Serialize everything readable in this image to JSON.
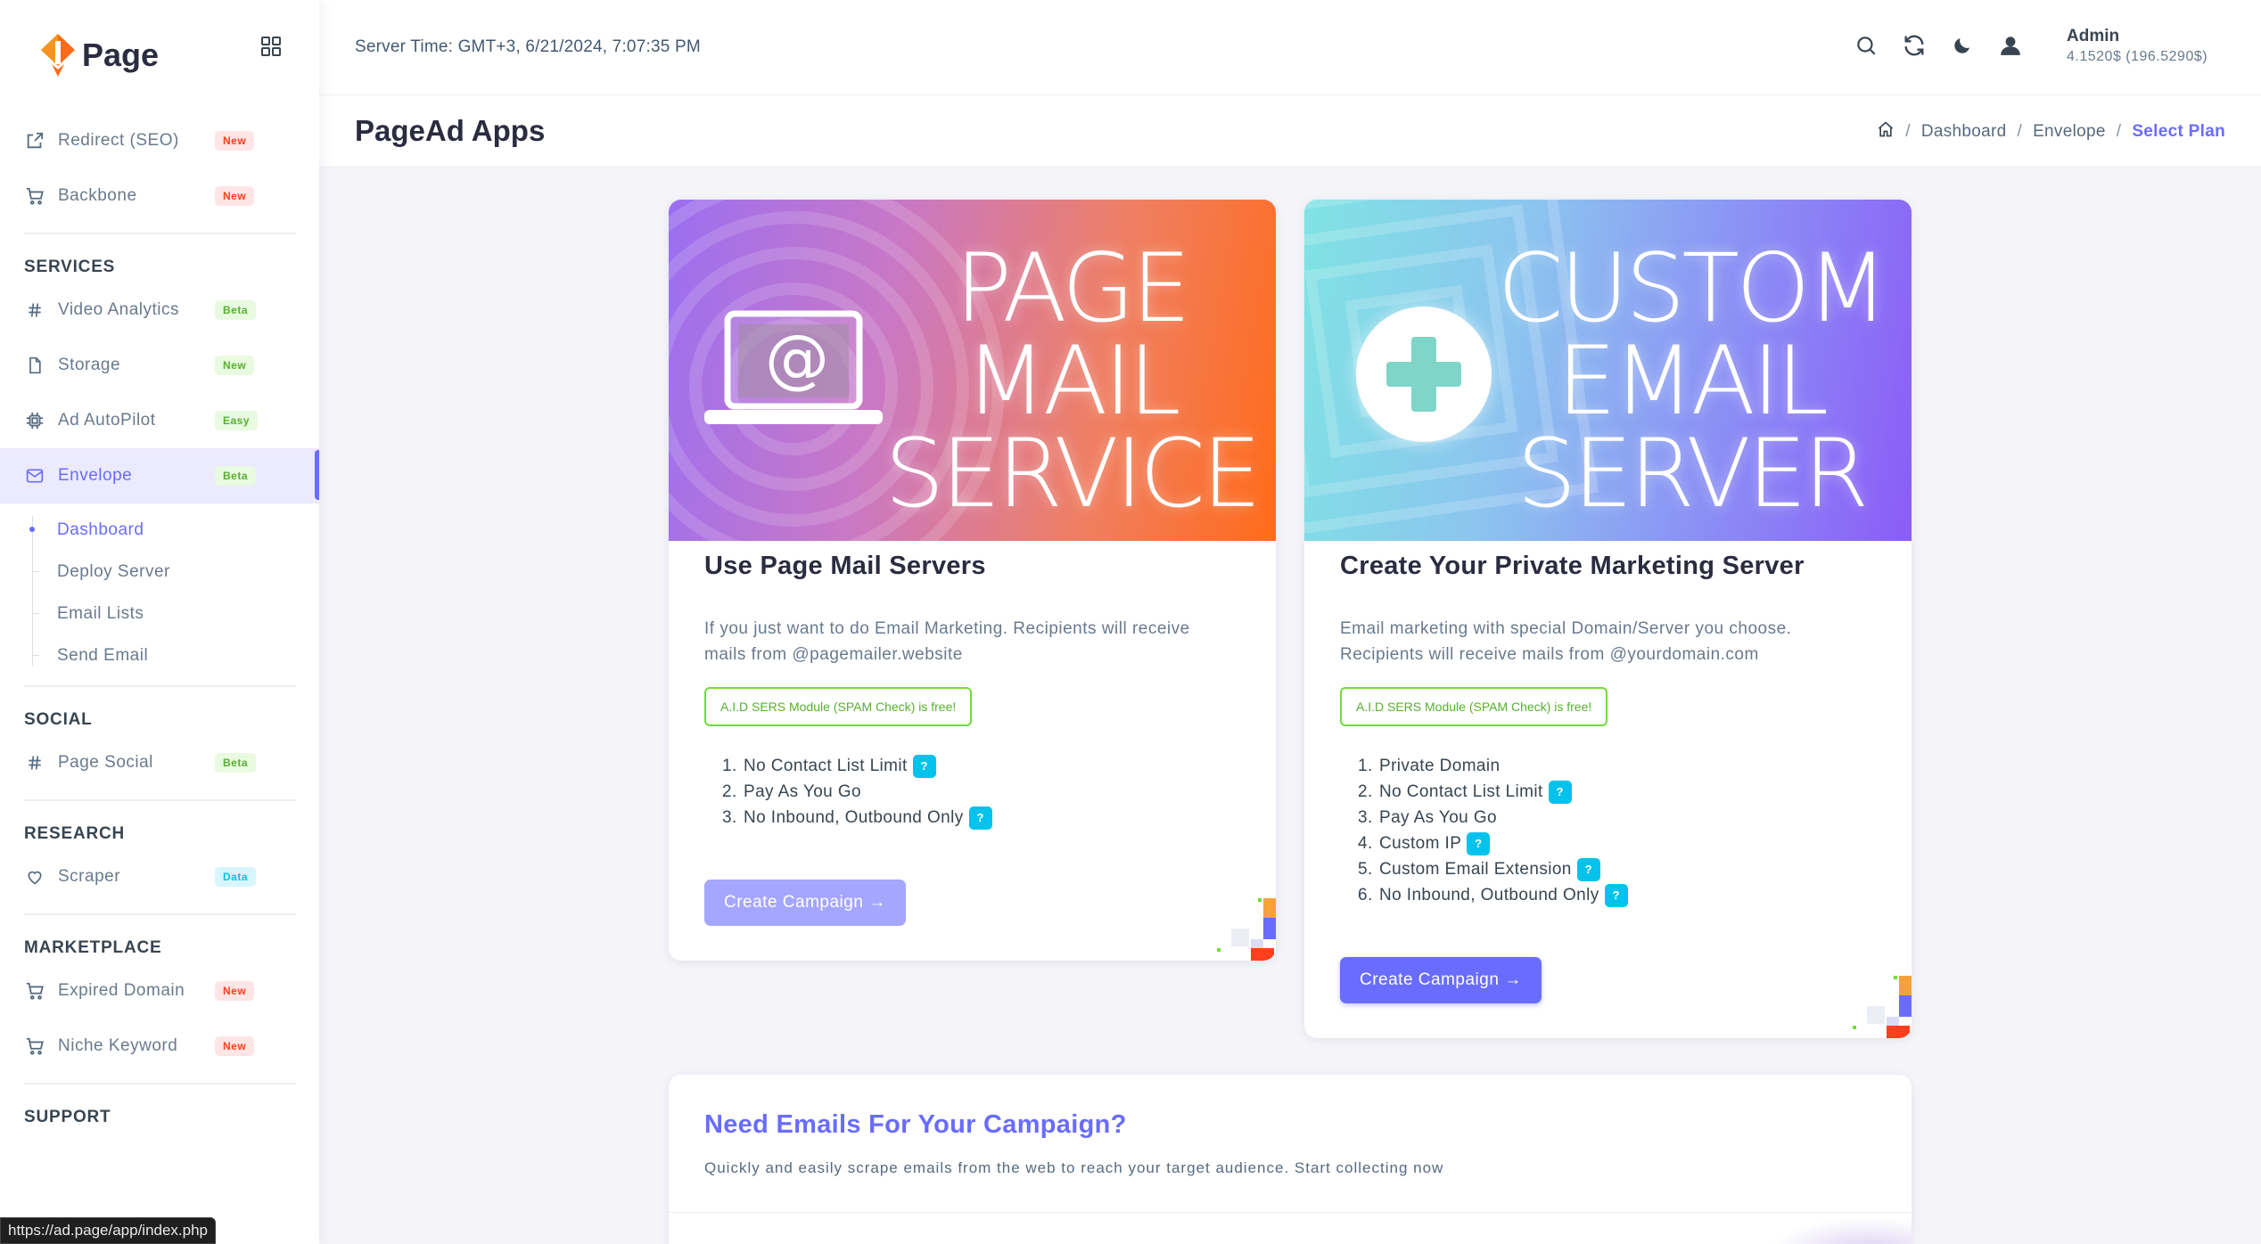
{
  "brand": {
    "name": "Page"
  },
  "sidebar": {
    "top_items": [
      {
        "label": "Redirect (SEO)",
        "badge": "New"
      },
      {
        "label": "Backbone",
        "badge": "New"
      }
    ],
    "services_title": "SERVICES",
    "services": [
      {
        "label": "Video Analytics",
        "badge": "Beta"
      },
      {
        "label": "Storage",
        "badge": "New"
      },
      {
        "label": "Ad AutoPilot",
        "badge": "Easy"
      },
      {
        "label": "Envelope",
        "badge": "Beta"
      }
    ],
    "envelope_sub": [
      "Dashboard",
      "Deploy Server",
      "Email Lists",
      "Send Email"
    ],
    "social_title": "SOCIAL",
    "social": [
      {
        "label": "Page Social",
        "badge": "Beta"
      }
    ],
    "research_title": "RESEARCH",
    "research": [
      {
        "label": "Scraper",
        "badge": "Data"
      }
    ],
    "marketplace_title": "MARKETPLACE",
    "marketplace": [
      {
        "label": "Expired Domain",
        "badge": "New"
      },
      {
        "label": "Niche Keyword",
        "badge": "New"
      }
    ],
    "support_title": "SUPPORT"
  },
  "status_bar": {
    "url": "https://ad.page/app/index.php"
  },
  "topbar": {
    "server_time": "Server Time: GMT+3, 6/21/2024, 7:07:35 PM",
    "user_name": "Admin",
    "balance": "4.1520$ (196.5290$)"
  },
  "header": {
    "title": "PageAd Apps",
    "breadcrumb": [
      "Dashboard",
      "Envelope",
      "Select Plan"
    ]
  },
  "cards": {
    "page_mail": {
      "hero_lines": [
        "PAGE",
        "MAIL",
        "SERVICE"
      ],
      "title": "Use Page Mail Servers",
      "desc_1": "If you just want to do Email Marketing. Recipients will receive",
      "desc_2": "mails from @pagemailer.website",
      "free_note": "A.I.D SERS Module (SPAM Check) is free!",
      "features": [
        "No Contact List Limit",
        "Pay As You Go",
        "No Inbound, Outbound Only"
      ],
      "button": "Create Campaign →"
    },
    "custom": {
      "hero_lines": [
        "CUSTOM",
        "EMAIL",
        "SERVER"
      ],
      "title": "Create Your Private Marketing Server",
      "desc_1": "Email marketing with special Domain/Server you choose.",
      "desc_2": "Recipients will receive mails from @yourdomain.com",
      "free_note": "A.I.D SERS Module (SPAM Check) is free!",
      "features": [
        "Private Domain",
        "No Contact List Limit",
        "Pay As You Go",
        "Custom IP",
        "Custom Email Extension",
        "No Inbound, Outbound Only"
      ],
      "button": "Create Campaign →"
    },
    "emails": {
      "title": "Need Emails For Your Campaign?",
      "subtitle": "Quickly and easily scrape emails from the web to reach your target audience. Start collecting now"
    }
  },
  "misc": {
    "help_glyph": "?",
    "at_glyph": "@"
  },
  "colors": {
    "primary": "#696cff",
    "info": "#03c3ec",
    "success": "#71dd37"
  }
}
